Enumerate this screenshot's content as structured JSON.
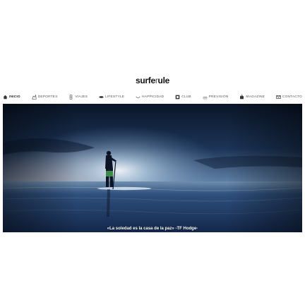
{
  "brand": {
    "part1": "surfe",
    "part2": "r",
    "part3": "ule"
  },
  "nav": {
    "items": [
      {
        "label": "INICIO",
        "icon": "home-icon"
      },
      {
        "label": "DEPORTES",
        "icon": "sports-icon"
      },
      {
        "label": "VIAJES",
        "icon": "travel-icon"
      },
      {
        "label": "LIFESTYLE",
        "icon": "surfboard-icon"
      },
      {
        "label": "HAPPICIDAD",
        "icon": "smile-icon"
      },
      {
        "label": "CLUB",
        "icon": "club-icon"
      },
      {
        "label": "PREVISIÓN",
        "icon": "forecast-icon"
      },
      {
        "label": "MAGAZINE",
        "icon": "bag-icon"
      },
      {
        "label": "CONTACTO",
        "icon": "mail-icon"
      }
    ]
  },
  "hero": {
    "caption": "«La soledad es la casa de la paz» -TF Hodge-"
  },
  "colors": {
    "sky_top": "#0d1a2e",
    "sky_glow": "#cfe3f3",
    "sea": "#1d3a66",
    "text": "#555555"
  }
}
